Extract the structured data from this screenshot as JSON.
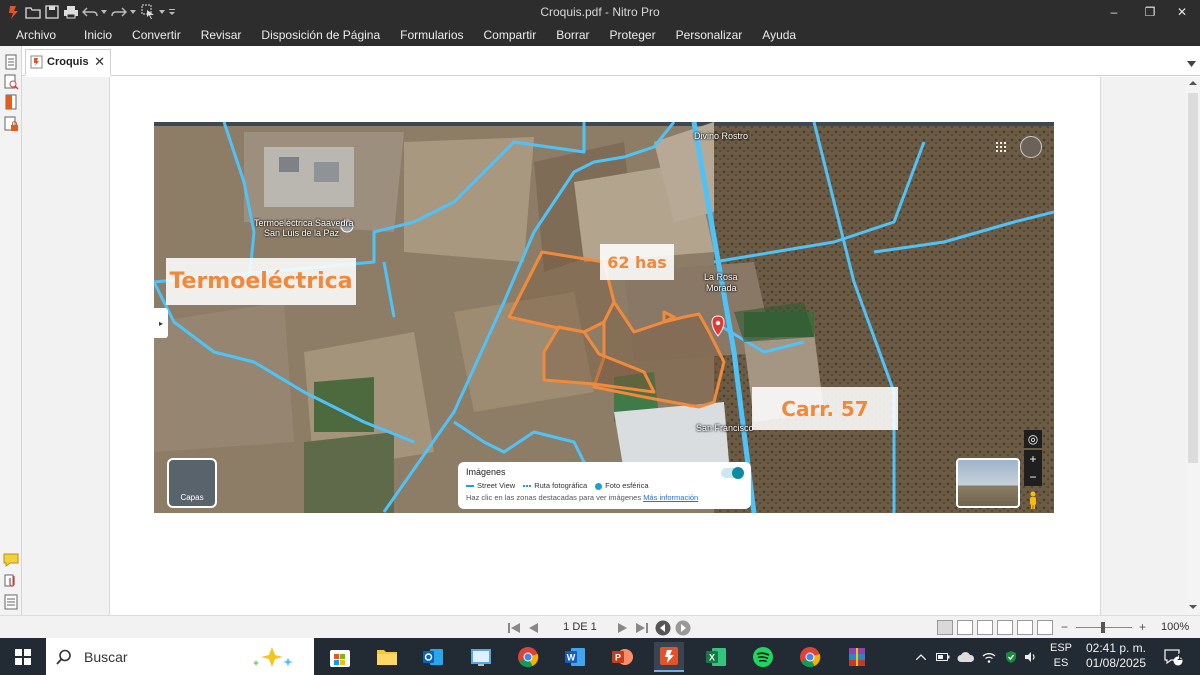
{
  "window": {
    "title": "Croquis.pdf - Nitro Pro",
    "minimize": "–",
    "restore": "❐",
    "close": "✕"
  },
  "menu": {
    "items": [
      "Archivo",
      "Inicio",
      "Convertir",
      "Revisar",
      "Disposición de Página",
      "Formularios",
      "Compartir",
      "Borrar",
      "Proteger",
      "Personalizar",
      "Ayuda"
    ]
  },
  "tab": {
    "label": "Croquis",
    "close": "✕"
  },
  "map": {
    "labels": {
      "termo_place": "Termoeléctrica Saavedra",
      "termo_place2": "San Luis de la Paz",
      "divino_rostro": "Divino Rostro",
      "la_rosa_1": "La Rosa",
      "la_rosa_2": "Morada",
      "san_francisco": "San Francisco"
    },
    "annotations": {
      "termoelectrica": "Termoeléctrica",
      "has": "62 has",
      "carr": "Carr. 57"
    },
    "layers_label": "Capas",
    "imagery": {
      "title": "Imágenes",
      "street_view": "Street View",
      "ruta": "Ruta fotográfica",
      "foto": "Foto esférica",
      "note": "Haz clic en las zonas destacadas para ver imágenes",
      "more": "Más información"
    },
    "zoom_in": "+",
    "zoom_out": "−"
  },
  "statusbar": {
    "page_indicator": "1 DE 1",
    "zoom": "100%",
    "zoom_minus": "−",
    "zoom_plus": "+"
  },
  "taskbar": {
    "search_placeholder": "Buscar",
    "lang_top": "ESP",
    "lang_bottom": "ES",
    "time": "02:41 p. m.",
    "date": "01/08/2025",
    "notifications": "1"
  },
  "colors": {
    "titlebar": "#2d2d2d",
    "orange": "#f2883a",
    "road_cyan": "#4fc3f7",
    "taskbar": "#222a33"
  }
}
